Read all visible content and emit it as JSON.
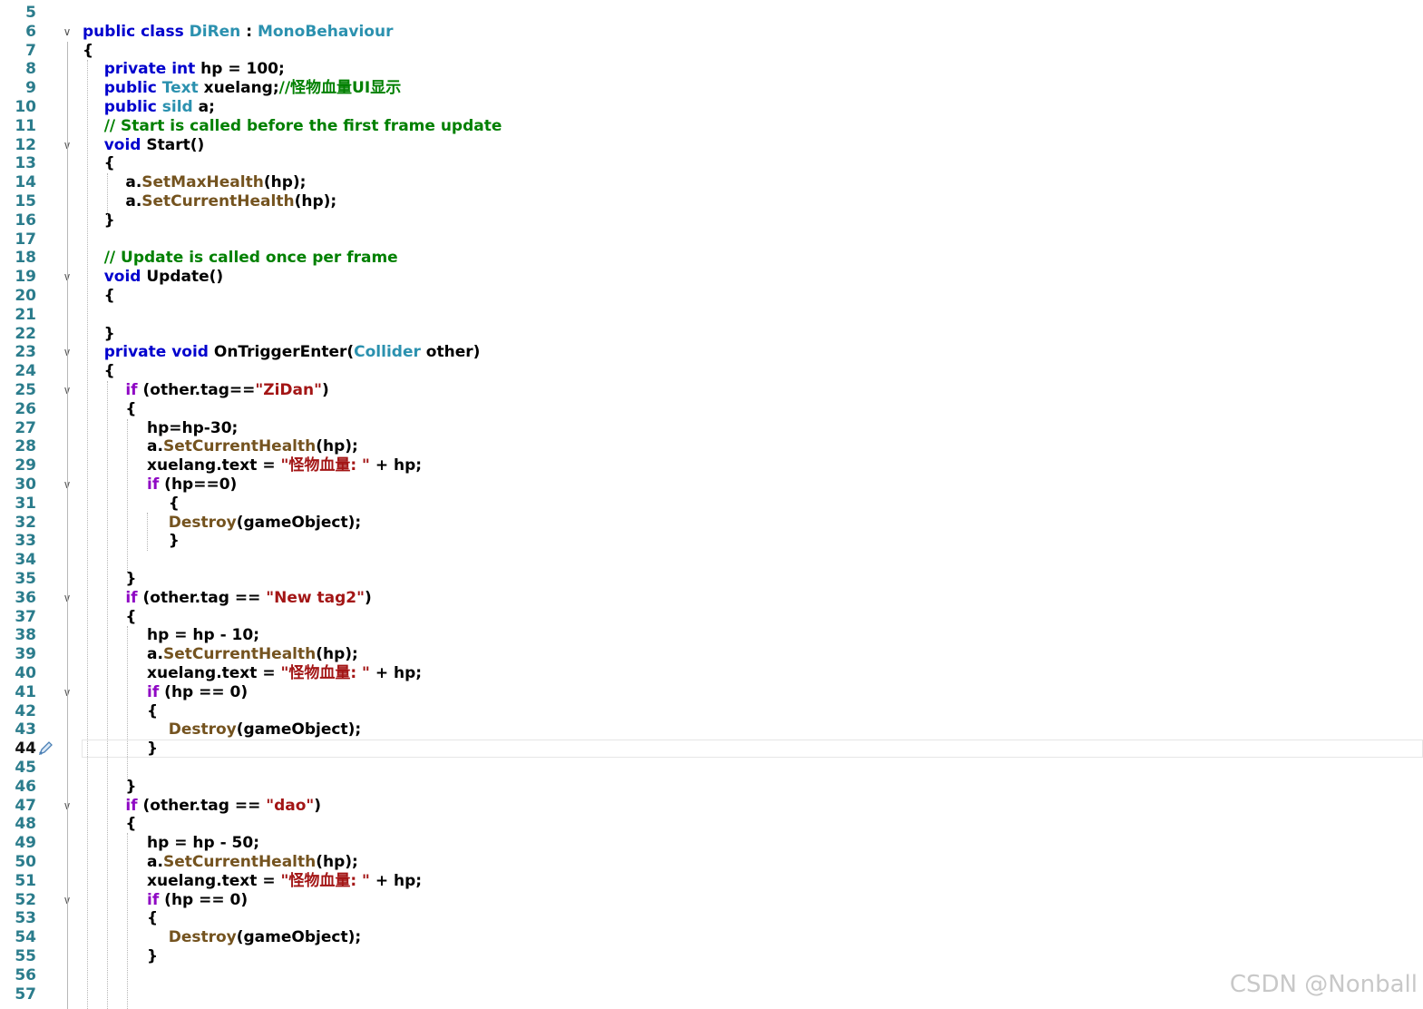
{
  "editor": {
    "current_line": 44,
    "lines": [
      {
        "n": 5,
        "fold": false,
        "tokens": []
      },
      {
        "n": 6,
        "fold": true,
        "tokens": [
          [
            "kw",
            "public class "
          ],
          [
            "ty",
            "DiRen"
          ],
          [
            "pl",
            " : "
          ],
          [
            "ty",
            "MonoBehaviour"
          ]
        ]
      },
      {
        "n": 7,
        "fold": false,
        "tokens": [
          [
            "pl",
            "{"
          ]
        ]
      },
      {
        "n": 8,
        "fold": false,
        "tokens": [
          [
            "pl",
            "    "
          ],
          [
            "kw",
            "private int "
          ],
          [
            "pl",
            "hp = 100;"
          ]
        ]
      },
      {
        "n": 9,
        "fold": false,
        "tokens": [
          [
            "pl",
            "    "
          ],
          [
            "kw",
            "public "
          ],
          [
            "ty",
            "Text"
          ],
          [
            "pl",
            " xuelang;"
          ],
          [
            "cm",
            "//怪物血量UI显示"
          ]
        ]
      },
      {
        "n": 10,
        "fold": false,
        "tokens": [
          [
            "pl",
            "    "
          ],
          [
            "kw",
            "public "
          ],
          [
            "ty",
            "sild"
          ],
          [
            "pl",
            " a;"
          ]
        ]
      },
      {
        "n": 11,
        "fold": false,
        "tokens": [
          [
            "pl",
            "    "
          ],
          [
            "cm",
            "// Start is called before the first frame update"
          ]
        ]
      },
      {
        "n": 12,
        "fold": true,
        "tokens": [
          [
            "pl",
            "    "
          ],
          [
            "kw",
            "void "
          ],
          [
            "pl",
            "Start()"
          ]
        ]
      },
      {
        "n": 13,
        "fold": false,
        "tokens": [
          [
            "pl",
            "    {"
          ]
        ]
      },
      {
        "n": 14,
        "fold": false,
        "tokens": [
          [
            "pl",
            "        a."
          ],
          [
            "fn",
            "SetMaxHealth"
          ],
          [
            "pl",
            "(hp);"
          ]
        ]
      },
      {
        "n": 15,
        "fold": false,
        "tokens": [
          [
            "pl",
            "        a."
          ],
          [
            "fn",
            "SetCurrentHealth"
          ],
          [
            "pl",
            "(hp);"
          ]
        ]
      },
      {
        "n": 16,
        "fold": false,
        "tokens": [
          [
            "pl",
            "    }"
          ]
        ]
      },
      {
        "n": 17,
        "fold": false,
        "tokens": []
      },
      {
        "n": 18,
        "fold": false,
        "tokens": [
          [
            "pl",
            "    "
          ],
          [
            "cm",
            "// Update is called once per frame"
          ]
        ]
      },
      {
        "n": 19,
        "fold": true,
        "tokens": [
          [
            "pl",
            "    "
          ],
          [
            "kw",
            "void "
          ],
          [
            "pl",
            "Update()"
          ]
        ]
      },
      {
        "n": 20,
        "fold": false,
        "tokens": [
          [
            "pl",
            "    {"
          ]
        ]
      },
      {
        "n": 21,
        "fold": false,
        "tokens": []
      },
      {
        "n": 22,
        "fold": false,
        "tokens": [
          [
            "pl",
            "    }"
          ]
        ]
      },
      {
        "n": 23,
        "fold": true,
        "tokens": [
          [
            "pl",
            "    "
          ],
          [
            "kw",
            "private void "
          ],
          [
            "pl",
            "OnTriggerEnter("
          ],
          [
            "ty",
            "Collider"
          ],
          [
            "pl",
            " other)"
          ]
        ]
      },
      {
        "n": 24,
        "fold": false,
        "tokens": [
          [
            "pl",
            "    {"
          ]
        ]
      },
      {
        "n": 25,
        "fold": true,
        "tokens": [
          [
            "pl",
            "        "
          ],
          [
            "ctl",
            "if"
          ],
          [
            "pl",
            " (other.tag=="
          ],
          [
            "str",
            "\"ZiDan\""
          ],
          [
            "pl",
            ")"
          ]
        ]
      },
      {
        "n": 26,
        "fold": false,
        "tokens": [
          [
            "pl",
            "        {"
          ]
        ]
      },
      {
        "n": 27,
        "fold": false,
        "tokens": [
          [
            "pl",
            "            hp=hp-30;"
          ]
        ]
      },
      {
        "n": 28,
        "fold": false,
        "tokens": [
          [
            "pl",
            "            a."
          ],
          [
            "fn",
            "SetCurrentHealth"
          ],
          [
            "pl",
            "(hp);"
          ]
        ]
      },
      {
        "n": 29,
        "fold": false,
        "tokens": [
          [
            "pl",
            "            xuelang.text = "
          ],
          [
            "str",
            "\"怪物血量: \""
          ],
          [
            "pl",
            " + hp;"
          ]
        ]
      },
      {
        "n": 30,
        "fold": true,
        "tokens": [
          [
            "pl",
            "            "
          ],
          [
            "ctl",
            "if"
          ],
          [
            "pl",
            " (hp==0)"
          ]
        ]
      },
      {
        "n": 31,
        "fold": false,
        "tokens": [
          [
            "pl",
            "                {"
          ]
        ]
      },
      {
        "n": 32,
        "fold": false,
        "tokens": [
          [
            "pl",
            "                "
          ],
          [
            "fn",
            "Destroy"
          ],
          [
            "pl",
            "(gameObject);"
          ]
        ]
      },
      {
        "n": 33,
        "fold": false,
        "tokens": [
          [
            "pl",
            "                }"
          ]
        ]
      },
      {
        "n": 34,
        "fold": false,
        "tokens": []
      },
      {
        "n": 35,
        "fold": false,
        "tokens": [
          [
            "pl",
            "        }"
          ]
        ]
      },
      {
        "n": 36,
        "fold": true,
        "tokens": [
          [
            "pl",
            "        "
          ],
          [
            "ctl",
            "if"
          ],
          [
            "pl",
            " (other.tag == "
          ],
          [
            "str",
            "\"New tag2\""
          ],
          [
            "pl",
            ")"
          ]
        ]
      },
      {
        "n": 37,
        "fold": false,
        "tokens": [
          [
            "pl",
            "        {"
          ]
        ]
      },
      {
        "n": 38,
        "fold": false,
        "tokens": [
          [
            "pl",
            "            hp = hp - 10;"
          ]
        ]
      },
      {
        "n": 39,
        "fold": false,
        "tokens": [
          [
            "pl",
            "            a."
          ],
          [
            "fn",
            "SetCurrentHealth"
          ],
          [
            "pl",
            "(hp);"
          ]
        ]
      },
      {
        "n": 40,
        "fold": false,
        "tokens": [
          [
            "pl",
            "            xuelang.text = "
          ],
          [
            "str",
            "\"怪物血量: \""
          ],
          [
            "pl",
            " + hp;"
          ]
        ]
      },
      {
        "n": 41,
        "fold": true,
        "tokens": [
          [
            "pl",
            "            "
          ],
          [
            "ctl",
            "if"
          ],
          [
            "pl",
            " (hp == 0)"
          ]
        ]
      },
      {
        "n": 42,
        "fold": false,
        "tokens": [
          [
            "pl",
            "            {"
          ]
        ]
      },
      {
        "n": 43,
        "fold": false,
        "tokens": [
          [
            "pl",
            "                "
          ],
          [
            "fn",
            "Destroy"
          ],
          [
            "pl",
            "(gameObject);"
          ]
        ]
      },
      {
        "n": 44,
        "fold": false,
        "tokens": [
          [
            "pl",
            "            }"
          ]
        ]
      },
      {
        "n": 45,
        "fold": false,
        "tokens": []
      },
      {
        "n": 46,
        "fold": false,
        "tokens": [
          [
            "pl",
            "        }"
          ]
        ]
      },
      {
        "n": 47,
        "fold": true,
        "tokens": [
          [
            "pl",
            "        "
          ],
          [
            "ctl",
            "if"
          ],
          [
            "pl",
            " (other.tag == "
          ],
          [
            "str",
            "\"dao\""
          ],
          [
            "pl",
            ")"
          ]
        ]
      },
      {
        "n": 48,
        "fold": false,
        "tokens": [
          [
            "pl",
            "        {"
          ]
        ]
      },
      {
        "n": 49,
        "fold": false,
        "tokens": [
          [
            "pl",
            "            hp = hp - 50;"
          ]
        ]
      },
      {
        "n": 50,
        "fold": false,
        "tokens": [
          [
            "pl",
            "            a."
          ],
          [
            "fn",
            "SetCurrentHealth"
          ],
          [
            "pl",
            "(hp);"
          ]
        ]
      },
      {
        "n": 51,
        "fold": false,
        "tokens": [
          [
            "pl",
            "            xuelang.text = "
          ],
          [
            "str",
            "\"怪物血量: \""
          ],
          [
            "pl",
            " + hp;"
          ]
        ]
      },
      {
        "n": 52,
        "fold": true,
        "tokens": [
          [
            "pl",
            "            "
          ],
          [
            "ctl",
            "if"
          ],
          [
            "pl",
            " (hp == 0)"
          ]
        ]
      },
      {
        "n": 53,
        "fold": false,
        "tokens": [
          [
            "pl",
            "            {"
          ]
        ]
      },
      {
        "n": 54,
        "fold": false,
        "tokens": [
          [
            "pl",
            "                "
          ],
          [
            "fn",
            "Destroy"
          ],
          [
            "pl",
            "(gameObject);"
          ]
        ]
      },
      {
        "n": 55,
        "fold": false,
        "tokens": [
          [
            "pl",
            "            }"
          ]
        ]
      },
      {
        "n": 56,
        "fold": false,
        "tokens": []
      },
      {
        "n": 57,
        "fold": false,
        "tokens": []
      }
    ]
  },
  "watermark": "CSDN @Nonball",
  "colors": {
    "keyword": "#0000cd",
    "type": "#2b91af",
    "string": "#a31515",
    "comment": "#008000",
    "method": "#74531f",
    "control": "#8f08c4",
    "line_number": "#2b7c8c"
  }
}
